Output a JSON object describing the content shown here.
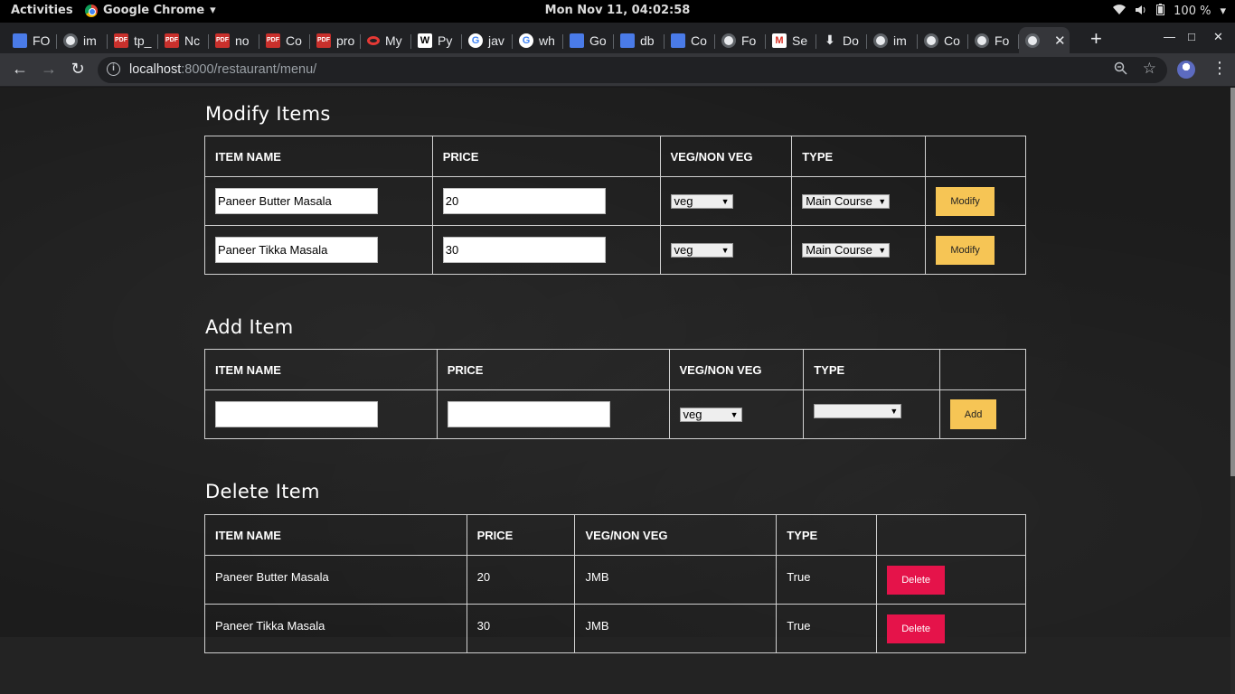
{
  "os": {
    "activities": "Activities",
    "app_name": "Google Chrome",
    "clock": "Mon Nov 11, 04:02:58",
    "battery": "100 %"
  },
  "tabs": [
    {
      "fav": "doc",
      "fav_text": "",
      "title": "FO"
    },
    {
      "fav": "globe",
      "fav_text": "",
      "title": "im"
    },
    {
      "fav": "pdf",
      "fav_text": "PDF",
      "title": "tp_"
    },
    {
      "fav": "pdf",
      "fav_text": "PDF",
      "title": "Nc"
    },
    {
      "fav": "pdf",
      "fav_text": "PDF",
      "title": "no"
    },
    {
      "fav": "pdf",
      "fav_text": "PDF",
      "title": "Co"
    },
    {
      "fav": "pdf",
      "fav_text": "PDF",
      "title": "pro"
    },
    {
      "fav": "opera",
      "fav_text": "",
      "title": "My"
    },
    {
      "fav": "wiki",
      "fav_text": "W",
      "title": "Py"
    },
    {
      "fav": "goog",
      "fav_text": "G",
      "title": "jav"
    },
    {
      "fav": "goog",
      "fav_text": "G",
      "title": "wh"
    },
    {
      "fav": "doc",
      "fav_text": "",
      "title": "Go"
    },
    {
      "fav": "doc",
      "fav_text": "",
      "title": "db"
    },
    {
      "fav": "doc",
      "fav_text": "",
      "title": "Co"
    },
    {
      "fav": "globe",
      "fav_text": "",
      "title": "Fo"
    },
    {
      "fav": "gmail",
      "fav_text": "M",
      "title": "Se"
    },
    {
      "fav": "dl",
      "fav_text": "⬇",
      "title": "Do"
    },
    {
      "fav": "globe",
      "fav_text": "",
      "title": "im"
    },
    {
      "fav": "globe",
      "fav_text": "",
      "title": "Co"
    },
    {
      "fav": "globe",
      "fav_text": "",
      "title": "Fo"
    }
  ],
  "active_tab": {
    "close": "✕"
  },
  "browser": {
    "url_host": "localhost",
    "url_rest": ":8000/restaurant/menu/"
  },
  "modify": {
    "title": "Modify Items",
    "headers": [
      "ITEM NAME",
      "PRICE",
      "VEG/NON VEG",
      "TYPE"
    ],
    "rows": [
      {
        "name": "Paneer Butter Masala",
        "price": "20",
        "veg": "veg",
        "type": "Main Course",
        "button": "Modify"
      },
      {
        "name": "Paneer Tikka Masala",
        "price": "30",
        "veg": "veg",
        "type": "Main Course",
        "button": "Modify"
      }
    ]
  },
  "add": {
    "title": "Add Item",
    "headers": [
      "ITEM NAME",
      "PRICE",
      "VEG/NON VEG",
      "TYPE"
    ],
    "name_value": "",
    "price_value": "",
    "veg": "veg",
    "type": "",
    "button": "Add"
  },
  "delete": {
    "title": "Delete Item",
    "headers": [
      "ITEM NAME",
      "PRICE",
      "VEG/NON VEG",
      "TYPE"
    ],
    "rows": [
      {
        "name": "Paneer Butter Masala",
        "price": "20",
        "veg": "JMB",
        "type": "True",
        "button": "Delete"
      },
      {
        "name": "Paneer Tikka Masala",
        "price": "30",
        "veg": "JMB",
        "type": "True",
        "button": "Delete"
      }
    ]
  }
}
